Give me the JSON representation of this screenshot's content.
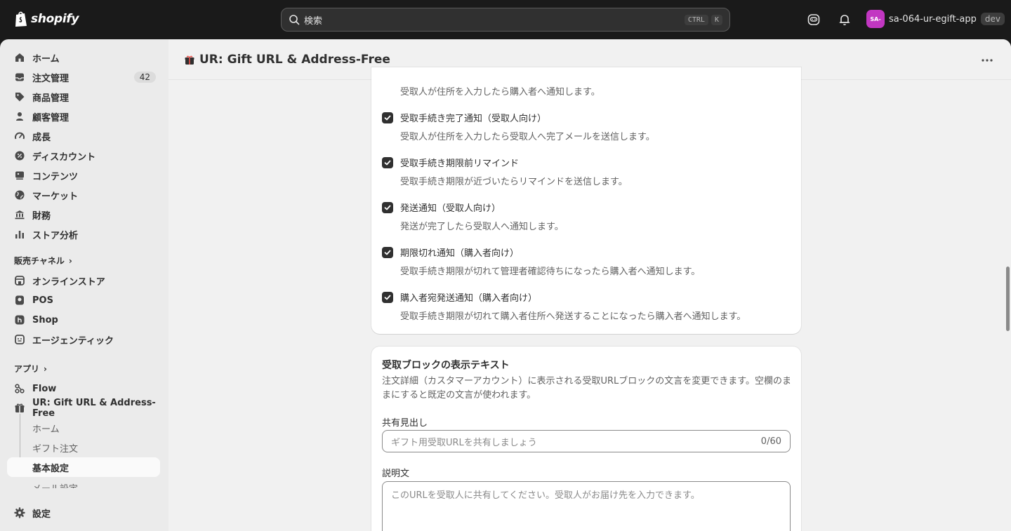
{
  "topbar": {
    "logo_text": "shopify",
    "search_placeholder": "検索",
    "shortcut_ctrl": "CTRL",
    "shortcut_key": "K",
    "avatar_initials": "SA-",
    "store_name": "sa-064-ur-egift-app",
    "env_badge": "dev",
    "colors": {
      "bg": "#1a1a1a",
      "avatar": "#c237c2"
    }
  },
  "sidebar": {
    "items": [
      {
        "label": "ホーム",
        "icon": "home-icon"
      },
      {
        "label": "注文管理",
        "icon": "inbox-icon",
        "badge": "42"
      },
      {
        "label": "商品管理",
        "icon": "tag-icon"
      },
      {
        "label": "顧客管理",
        "icon": "person-icon"
      },
      {
        "label": "成長",
        "icon": "gauge-icon"
      },
      {
        "label": "ディスカウント",
        "icon": "discount-icon"
      },
      {
        "label": "コンテンツ",
        "icon": "content-icon"
      },
      {
        "label": "マーケット",
        "icon": "globe-icon"
      },
      {
        "label": "財務",
        "icon": "bank-icon"
      },
      {
        "label": "ストア分析",
        "icon": "bar-chart-icon"
      }
    ],
    "sales_channels_label": "販売チャネル",
    "channels": [
      {
        "label": "オンラインストア",
        "icon": "store-icon"
      },
      {
        "label": "POS",
        "icon": "pos-icon"
      },
      {
        "label": "Shop",
        "icon": "shop-icon"
      },
      {
        "label": "エージェンティック",
        "icon": "agentic-icon"
      }
    ],
    "apps_label": "アプリ",
    "apps": [
      {
        "label": "Flow",
        "icon": "flow-icon"
      },
      {
        "label": "UR: Gift URL & Address-Free",
        "icon": "gift-icon"
      }
    ],
    "app_subitems": [
      "ホーム",
      "ギフト注文",
      "基本設定",
      "メール設定"
    ],
    "active_subitem": "基本設定",
    "settings_label": "設定"
  },
  "main": {
    "app_title": "UR: Gift URL & Address-Free",
    "notifications": [
      {
        "label": "",
        "desc": "受取人が住所を入力したら購入者へ通知します。",
        "checked": true
      },
      {
        "label": "受取手続き完了通知（受取人向け）",
        "desc": "受取人が住所を入力したら受取人へ完了メールを送信します。",
        "checked": true
      },
      {
        "label": "受取手続き期限前リマインド",
        "desc": "受取手続き期限が近づいたらリマインドを送信します。",
        "checked": true
      },
      {
        "label": "発送通知（受取人向け）",
        "desc": "発送が完了したら受取人へ通知します。",
        "checked": true
      },
      {
        "label": "期限切れ通知（購入者向け）",
        "desc": "受取手続き期限が切れて管理者確認待ちになったら購入者へ通知します。",
        "checked": true
      },
      {
        "label": "購入者宛発送通知（購入者向け）",
        "desc": "受取手続き期限が切れて購入者住所へ発送することになったら購入者へ通知します。",
        "checked": true
      }
    ],
    "display_text_card": {
      "heading": "受取ブロックの表示テキスト",
      "intro": "注文詳細（カスタマーアカウント）に表示される受取URLブロックの文言を変更できます。空欄のままにすると既定の文言が使われます。",
      "shared_heading_label": "共有見出し",
      "shared_heading_placeholder": "ギフト用受取URLを共有しましょう",
      "shared_heading_value": "",
      "shared_heading_count": "0/60",
      "description_label": "説明文",
      "description_placeholder": "このURLを受取人に共有してください。受取人がお届け先を入力できます。",
      "description_value": ""
    }
  }
}
